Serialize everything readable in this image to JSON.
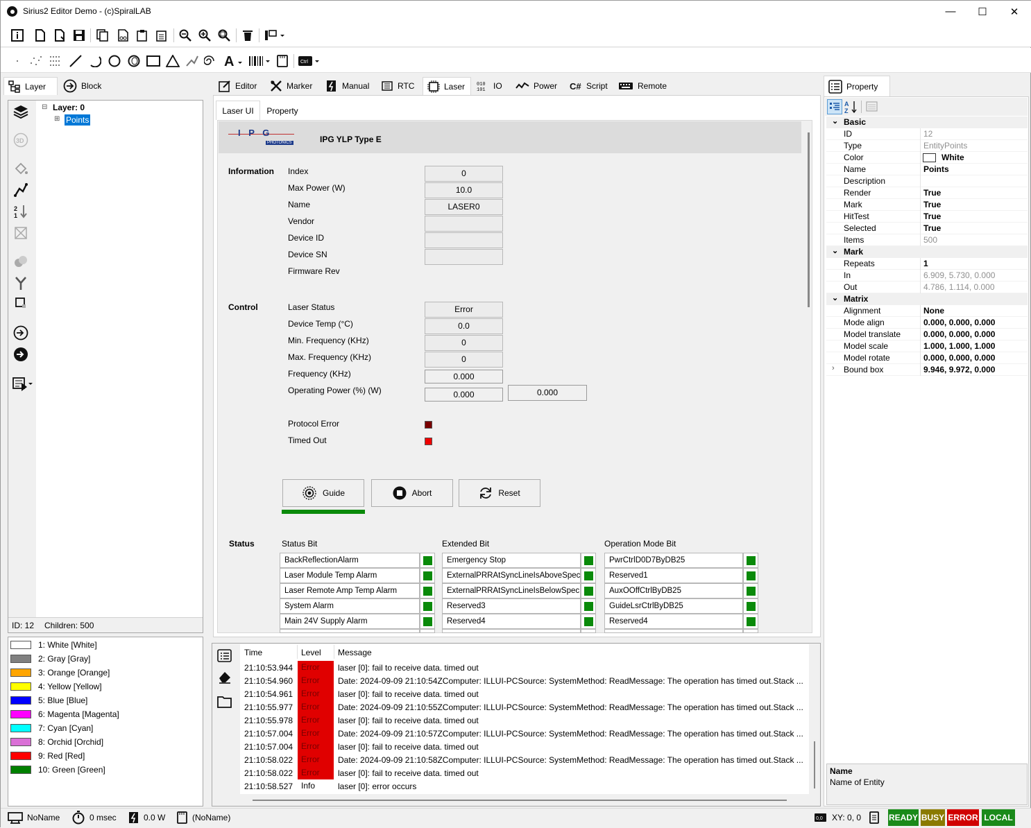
{
  "window": {
    "title": "Sirius2 Editor Demo - (c)SpiralLAB",
    "minimize": "—",
    "maximize": "☐",
    "close": "✕"
  },
  "left_tabs": [
    {
      "label": "Layer",
      "icon": "layer-tree-icon"
    },
    {
      "label": "Block",
      "icon": "block-icon"
    }
  ],
  "tree": {
    "root": "Layer: 0",
    "child": "Points",
    "expander": "⊟",
    "child_expander": "⊞"
  },
  "layer_status": {
    "id": "ID: 12",
    "children": "Children: 500"
  },
  "colors": [
    {
      "label": "1: White [White]",
      "hex": "#ffffff"
    },
    {
      "label": "2: Gray [Gray]",
      "hex": "#808080"
    },
    {
      "label": "3: Orange [Orange]",
      "hex": "#ffa500"
    },
    {
      "label": "4: Yellow [Yellow]",
      "hex": "#ffff00"
    },
    {
      "label": "5: Blue [Blue]",
      "hex": "#0000ff"
    },
    {
      "label": "6: Magenta [Magenta]",
      "hex": "#ff00ff"
    },
    {
      "label": "7: Cyan [Cyan]",
      "hex": "#00ffff"
    },
    {
      "label": "8: Orchid [Orchid]",
      "hex": "#da70d6"
    },
    {
      "label": "9: Red [Red]",
      "hex": "#ff0000"
    },
    {
      "label": "10: Green [Green]",
      "hex": "#008000"
    }
  ],
  "main_tabs": [
    "Editor",
    "Marker",
    "Manual",
    "RTC",
    "Laser",
    "IO",
    "Power",
    "Script",
    "Remote"
  ],
  "sub_tabs": [
    "Laser UI",
    "Property"
  ],
  "laser": {
    "logo_text": "I P G",
    "logo_sub": "PHOTONICS",
    "model": "IPG YLP Type E",
    "info_header": "Information",
    "info": [
      {
        "label": "Index",
        "value": "0"
      },
      {
        "label": "Max Power (W)",
        "value": "10.0"
      },
      {
        "label": "Name",
        "value": "LASER0"
      },
      {
        "label": "Vendor",
        "value": ""
      },
      {
        "label": "Device ID",
        "value": ""
      },
      {
        "label": "Device SN",
        "value": ""
      },
      {
        "label": "Firmware Rev",
        "value": ""
      }
    ],
    "control_header": "Control",
    "control": [
      {
        "label": "Laser Status",
        "value": "Error"
      },
      {
        "label": "Device Temp (°C)",
        "value": "0.0"
      },
      {
        "label": "Min. Frequency (KHz)",
        "value": "0"
      },
      {
        "label": "Max. Frequency (KHz)",
        "value": "0"
      },
      {
        "label": "Frequency (KHz)",
        "value": "0.000"
      },
      {
        "label": "Operating Power (%) (W)",
        "value": "0.000",
        "value2": "0.000"
      }
    ],
    "protocol_error": "Protocol Error",
    "timed_out": "Timed Out",
    "buttons": {
      "guide": "Guide",
      "abort": "Abort",
      "reset": "Reset"
    },
    "guide_progress": 1.0,
    "status_header": "Status",
    "status_bit_header": "Status Bit",
    "extended_bit_header": "Extended Bit",
    "opmode_bit_header": "Operation Mode Bit",
    "status_bits": [
      "BackReflectionAlarm",
      "Laser Module Temp Alarm",
      "Laser Remote Amp Temp Alarm",
      "System Alarm",
      "Main 24V Supply Alarm"
    ],
    "extended_bits": [
      "Emergency Stop",
      "ExternalPRRAtSyncLineIsAboveSpec",
      "ExternalPRRAtSyncLineIsBelowSpec",
      "Reserved3",
      "Reserved4"
    ],
    "opmode_bits": [
      "PwrCtrlD0D7ByDB25",
      "Reserved1",
      "AuxOOffCtrlByDB25",
      "GuideLsrCtrlByDB25",
      "Reserved4"
    ]
  },
  "log": {
    "headers": {
      "time": "Time",
      "level": "Level",
      "message": "Message"
    },
    "rows": [
      {
        "time": "21:10:53.944",
        "level": "Error",
        "message": "laser [0]: fail to receive data. timed out"
      },
      {
        "time": "21:10:54.960",
        "level": "Error",
        "message": "Date: 2024-09-09 21:10:54ZComputer: ILLUI-PCSource: SystemMethod: ReadMessage: The operation has timed out.Stack ..."
      },
      {
        "time": "21:10:54.961",
        "level": "Error",
        "message": "laser [0]: fail to receive data. timed out"
      },
      {
        "time": "21:10:55.977",
        "level": "Error",
        "message": "Date: 2024-09-09 21:10:55ZComputer: ILLUI-PCSource: SystemMethod: ReadMessage: The operation has timed out.Stack ..."
      },
      {
        "time": "21:10:55.978",
        "level": "Error",
        "message": "laser [0]: fail to receive data. timed out"
      },
      {
        "time": "21:10:57.004",
        "level": "Error",
        "message": "Date: 2024-09-09 21:10:57ZComputer: ILLUI-PCSource: SystemMethod: ReadMessage: The operation has timed out.Stack ..."
      },
      {
        "time": "21:10:57.004",
        "level": "Error",
        "message": "laser [0]: fail to receive data. timed out"
      },
      {
        "time": "21:10:58.022",
        "level": "Error",
        "message": "Date: 2024-09-09 21:10:58ZComputer: ILLUI-PCSource: SystemMethod: ReadMessage: The operation has timed out.Stack ..."
      },
      {
        "time": "21:10:58.022",
        "level": "Error",
        "message": "laser [0]: fail to receive data. timed out"
      },
      {
        "time": "21:10:58.527",
        "level": "Info",
        "message": "laser [0]: error occurs"
      }
    ]
  },
  "property": {
    "tab": "Property",
    "categories": {
      "basic": "Basic",
      "mark": "Mark",
      "matrix": "Matrix"
    },
    "basic": [
      {
        "k": "ID",
        "v": "12",
        "grey": true
      },
      {
        "k": "Type",
        "v": "EntityPoints",
        "grey": true
      },
      {
        "k": "Color",
        "v": "White",
        "bold": true,
        "swatch": "#ffffff"
      },
      {
        "k": "Name",
        "v": "Points",
        "bold": true
      },
      {
        "k": "Description",
        "v": ""
      },
      {
        "k": "Render",
        "v": "True",
        "bold": true
      },
      {
        "k": "Mark",
        "v": "True",
        "bold": true
      },
      {
        "k": "HitTest",
        "v": "True",
        "bold": true
      },
      {
        "k": "Selected",
        "v": "True",
        "bold": true
      },
      {
        "k": "Items",
        "v": "500",
        "grey": true
      }
    ],
    "mark": [
      {
        "k": "Repeats",
        "v": "1",
        "bold": true
      },
      {
        "k": "In",
        "v": "6.909, 5.730, 0.000",
        "grey": true
      },
      {
        "k": "Out",
        "v": "4.786, 1.114, 0.000",
        "grey": true
      }
    ],
    "matrix": [
      {
        "k": "Alignment",
        "v": "None",
        "bold": true
      },
      {
        "k": "Mode align",
        "v": "0.000, 0.000, 0.000",
        "bold": true
      },
      {
        "k": "Model translate",
        "v": "0.000, 0.000, 0.000",
        "bold": true
      },
      {
        "k": "Model scale",
        "v": "1.000, 1.000, 1.000",
        "bold": true
      },
      {
        "k": "Model rotate",
        "v": "0.000, 0.000, 0.000",
        "bold": true
      },
      {
        "k": "Bound box",
        "v": "9.946, 9.972, 0.000",
        "bold": true,
        "expandable": true
      }
    ],
    "desc_title": "Name",
    "desc_text": "Name of Entity"
  },
  "statusbar": {
    "name": "NoName",
    "time": "0 msec",
    "power": "0.0 W",
    "doc": "(NoName)",
    "xy": "XY: 0, 0",
    "badges": [
      {
        "label": "READY",
        "bg": "#1a8a1a"
      },
      {
        "label": "BUSY",
        "bg": "#8a7a00"
      },
      {
        "label": "ERROR",
        "bg": "#d00000"
      },
      {
        "label": "LOCAL",
        "bg": "#1a8a1a"
      }
    ]
  }
}
